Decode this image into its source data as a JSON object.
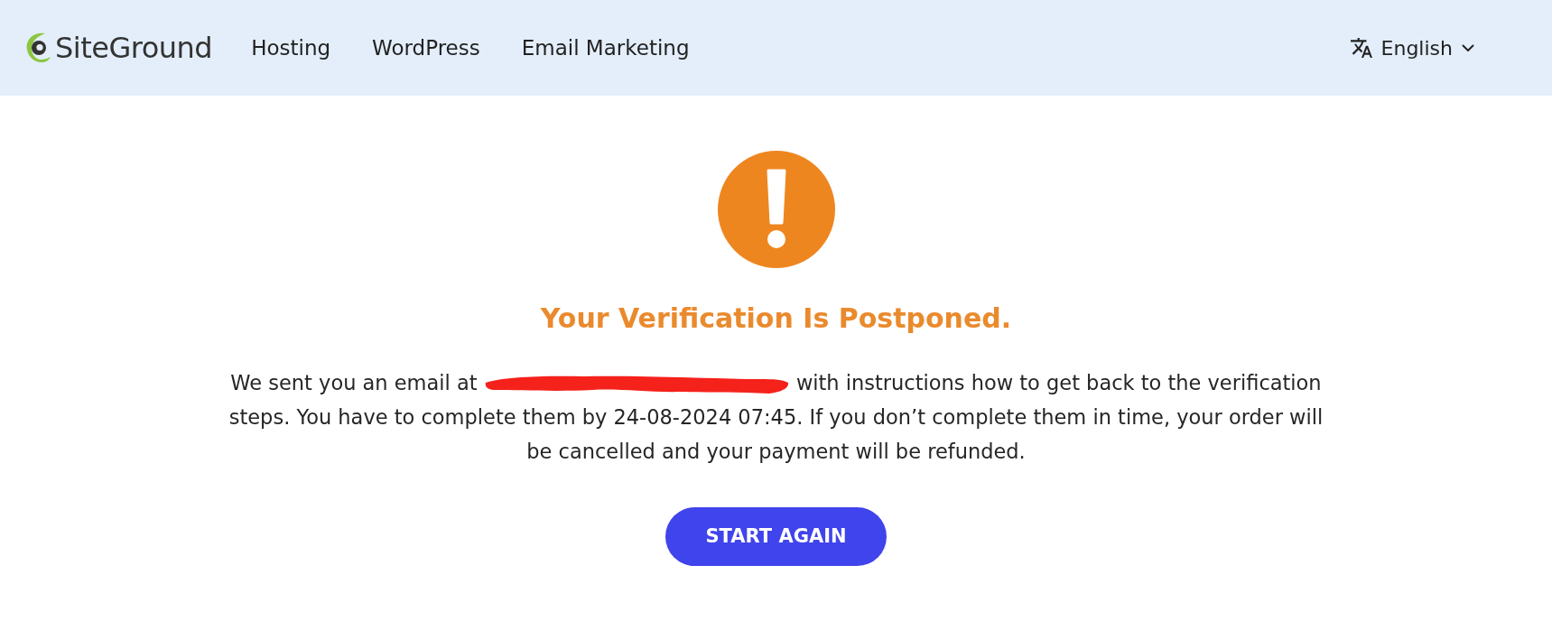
{
  "header": {
    "logo": {
      "text": "SiteGround"
    },
    "nav": [
      {
        "label": "Hosting"
      },
      {
        "label": "WordPress"
      },
      {
        "label": "Email Marketing"
      }
    ],
    "language": {
      "label": "English"
    }
  },
  "message": {
    "title": "Your Verification Is Postponed.",
    "body_before": "We sent you an email at",
    "email_redacted": true,
    "body_after": "with instructions how to get back to the verification steps. You have to complete them by 24-08-2024 07:45. If you don’t complete them in time, your order will be cancelled and your payment will be refunded.",
    "button": "START AGAIN"
  }
}
